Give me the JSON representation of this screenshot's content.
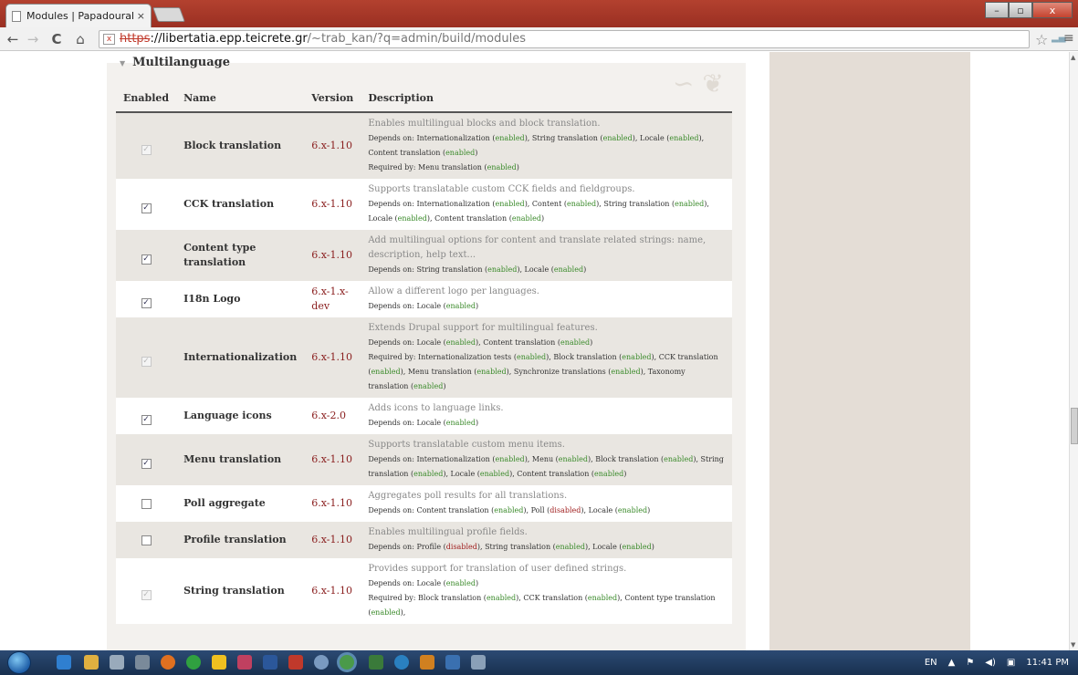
{
  "browser": {
    "tab_title": "Modules | Papadourakis G",
    "tab_close": "×",
    "url_scheme": "https",
    "url_host": "://libertatia.epp.teicrete.gr",
    "url_path": "/~trab_kan/?q=admin/build/modules",
    "back": "←",
    "forward": "→",
    "reload": "C",
    "home": "⌂",
    "star": "☆",
    "menu": "≡",
    "min": "–",
    "max": "▫",
    "close": "x"
  },
  "section": {
    "legend": "Multilanguage",
    "headers": {
      "enabled": "Enabled",
      "name": "Name",
      "version": "Version",
      "description": "Description"
    }
  },
  "modules": [
    {
      "checked": true,
      "disabled": true,
      "name": "Block translation",
      "version": "6.x-1.10",
      "desc": "Enables multilingual blocks and block translation.",
      "dep": [
        [
          "Depends on: Internationalization (",
          ""
        ],
        [
          "enabled",
          "en"
        ],
        [
          "), String translation (",
          ""
        ],
        [
          "enabled",
          "en"
        ],
        [
          "), Locale (",
          ""
        ],
        [
          "enabled",
          "en"
        ],
        [
          "), Content translation (",
          ""
        ],
        [
          "enabled",
          "en"
        ],
        [
          ")",
          ""
        ]
      ],
      "req": [
        [
          "Required by: Menu translation (",
          ""
        ],
        [
          "enabled",
          "en"
        ],
        [
          ")",
          ""
        ]
      ]
    },
    {
      "checked": true,
      "disabled": false,
      "name": "CCK translation",
      "version": "6.x-1.10",
      "desc": "Supports translatable custom CCK fields and fieldgroups.",
      "dep": [
        [
          "Depends on: Internationalization (",
          ""
        ],
        [
          "enabled",
          "en"
        ],
        [
          "), Content (",
          ""
        ],
        [
          "enabled",
          "en"
        ],
        [
          "), String translation (",
          ""
        ],
        [
          "enabled",
          "en"
        ],
        [
          "), Locale (",
          ""
        ],
        [
          "enabled",
          "en"
        ],
        [
          "), Content translation (",
          ""
        ],
        [
          "enabled",
          "en"
        ],
        [
          ")",
          ""
        ]
      ],
      "req": []
    },
    {
      "checked": true,
      "disabled": false,
      "name": "Content type translation",
      "version": "6.x-1.10",
      "desc": "Add multilingual options for content and translate related strings: name, description, help text...",
      "dep": [
        [
          "Depends on: String translation (",
          ""
        ],
        [
          "enabled",
          "en"
        ],
        [
          "), Locale (",
          ""
        ],
        [
          "enabled",
          "en"
        ],
        [
          ")",
          ""
        ]
      ],
      "req": []
    },
    {
      "checked": true,
      "disabled": false,
      "name": "I18n Logo",
      "version": "6.x-1.x-dev",
      "desc": "Allow a different logo per languages.",
      "dep": [
        [
          "Depends on: Locale (",
          ""
        ],
        [
          "enabled",
          "en"
        ],
        [
          ")",
          ""
        ]
      ],
      "req": []
    },
    {
      "checked": true,
      "disabled": true,
      "name": "Internationalization",
      "version": "6.x-1.10",
      "desc": "Extends Drupal support for multilingual features.",
      "dep": [
        [
          "Depends on: Locale (",
          ""
        ],
        [
          "enabled",
          "en"
        ],
        [
          "), Content translation (",
          ""
        ],
        [
          "enabled",
          "en"
        ],
        [
          ")",
          ""
        ]
      ],
      "req": [
        [
          "Required by: Internationalization tests (",
          ""
        ],
        [
          "enabled",
          "en"
        ],
        [
          "), Block translation (",
          ""
        ],
        [
          "enabled",
          "en"
        ],
        [
          "), CCK translation (",
          ""
        ],
        [
          "enabled",
          "en"
        ],
        [
          "), Menu translation (",
          ""
        ],
        [
          "enabled",
          "en"
        ],
        [
          "), Synchronize translations (",
          ""
        ],
        [
          "enabled",
          "en"
        ],
        [
          "), Taxonomy translation (",
          ""
        ],
        [
          "enabled",
          "en"
        ],
        [
          ")",
          ""
        ]
      ]
    },
    {
      "checked": true,
      "disabled": false,
      "name": "Language icons",
      "version": "6.x-2.0",
      "desc": "Adds icons to language links.",
      "dep": [
        [
          "Depends on: Locale (",
          ""
        ],
        [
          "enabled",
          "en"
        ],
        [
          ")",
          ""
        ]
      ],
      "req": []
    },
    {
      "checked": true,
      "disabled": false,
      "name": "Menu translation",
      "version": "6.x-1.10",
      "desc": "Supports translatable custom menu items.",
      "dep": [
        [
          "Depends on: Internationalization (",
          ""
        ],
        [
          "enabled",
          "en"
        ],
        [
          "), Menu (",
          ""
        ],
        [
          "enabled",
          "en"
        ],
        [
          "), Block translation (",
          ""
        ],
        [
          "enabled",
          "en"
        ],
        [
          "), String translation (",
          ""
        ],
        [
          "enabled",
          "en"
        ],
        [
          "), Locale (",
          ""
        ],
        [
          "enabled",
          "en"
        ],
        [
          "), Content translation (",
          ""
        ],
        [
          "enabled",
          "en"
        ],
        [
          ")",
          ""
        ]
      ],
      "req": []
    },
    {
      "checked": false,
      "disabled": false,
      "name": "Poll aggregate",
      "version": "6.x-1.10",
      "desc": "Aggregates poll results for all translations.",
      "dep": [
        [
          "Depends on: Content translation (",
          ""
        ],
        [
          "enabled",
          "en"
        ],
        [
          "), Poll (",
          ""
        ],
        [
          "disabled",
          "dis"
        ],
        [
          "), Locale (",
          ""
        ],
        [
          "enabled",
          "en"
        ],
        [
          ")",
          ""
        ]
      ],
      "req": []
    },
    {
      "checked": false,
      "disabled": false,
      "name": "Profile translation",
      "version": "6.x-1.10",
      "desc": "Enables multilingual profile fields.",
      "dep": [
        [
          "Depends on: Profile (",
          ""
        ],
        [
          "disabled",
          "dis"
        ],
        [
          "), String translation (",
          ""
        ],
        [
          "enabled",
          "en"
        ],
        [
          "), Locale (",
          ""
        ],
        [
          "enabled",
          "en"
        ],
        [
          ")",
          ""
        ]
      ],
      "req": []
    },
    {
      "checked": true,
      "disabled": true,
      "name": "String translation",
      "version": "6.x-1.10",
      "desc": "Provides support for translation of user defined strings.",
      "dep": [
        [
          "Depends on: Locale (",
          ""
        ],
        [
          "enabled",
          "en"
        ],
        [
          ")",
          ""
        ]
      ],
      "req": [
        [
          "Required by: Block translation (",
          ""
        ],
        [
          "enabled",
          "en"
        ],
        [
          "), CCK translation (",
          ""
        ],
        [
          "enabled",
          "en"
        ],
        [
          "), Content type translation (",
          ""
        ],
        [
          "enabled",
          "en"
        ],
        [
          "),",
          ""
        ]
      ]
    }
  ],
  "tray": {
    "lang": "EN",
    "time": "11:41 PM"
  },
  "colors": {
    "enabled": "#3a8a2a",
    "disabled": "#a02020",
    "version": "#8b2020",
    "odd_row": "#e9e6e1",
    "sidebar": "#e4ddd6"
  }
}
